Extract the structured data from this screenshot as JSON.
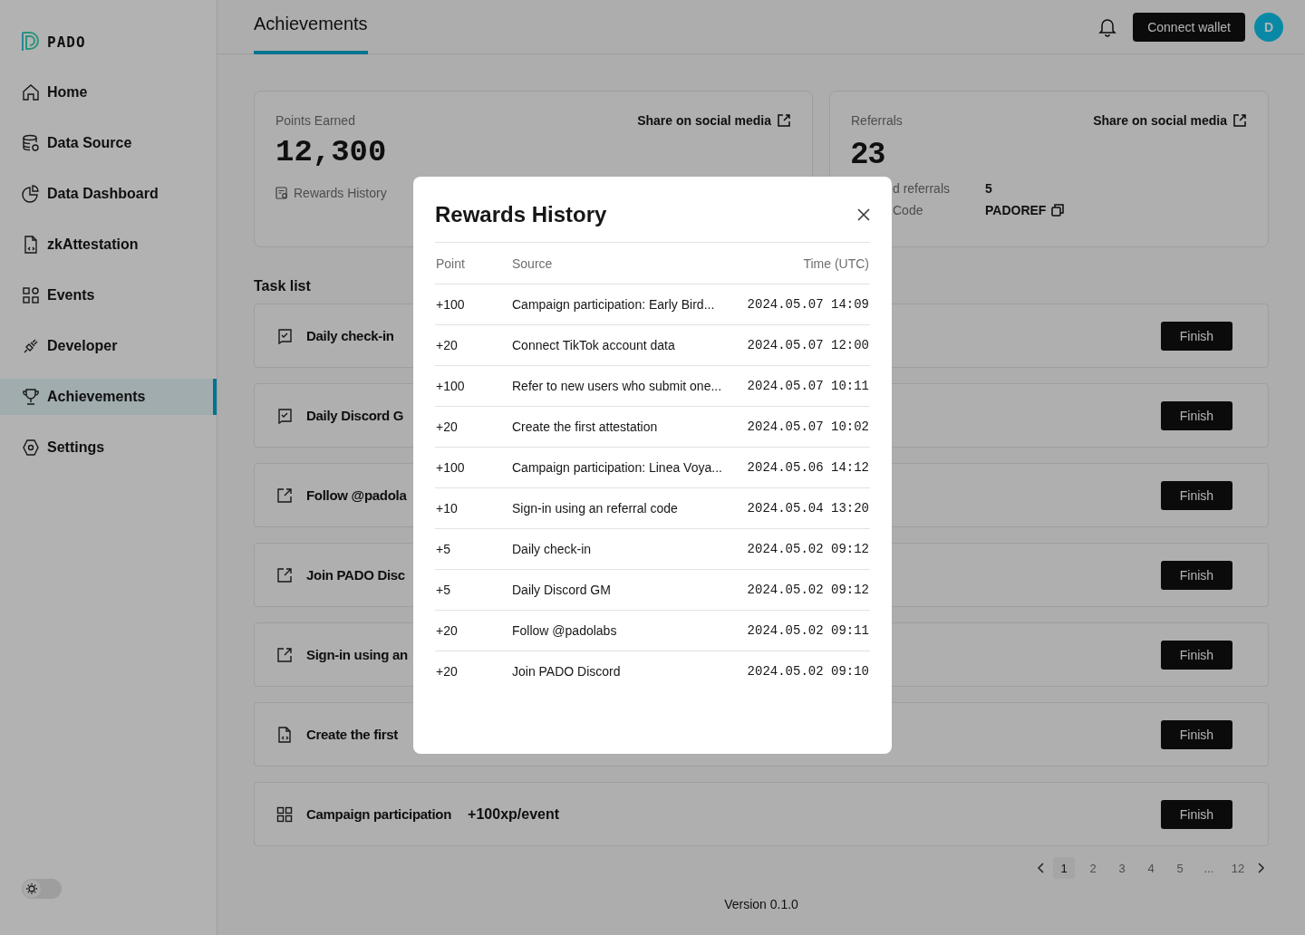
{
  "sidebar": {
    "logo": "PADO",
    "items": [
      {
        "label": "Home",
        "kind": "home",
        "selected": false
      },
      {
        "label": "Data Source",
        "kind": "database",
        "selected": false
      },
      {
        "label": "Data Dashboard",
        "kind": "pie",
        "selected": false
      },
      {
        "label": "zkAttestation",
        "kind": "file",
        "selected": false
      },
      {
        "label": "Events",
        "kind": "grid",
        "selected": false
      },
      {
        "label": "Developer",
        "kind": "plug",
        "selected": false
      },
      {
        "label": "Achievements",
        "kind": "trophy",
        "selected": true
      },
      {
        "label": "Settings",
        "kind": "gear",
        "selected": false
      }
    ],
    "theme_toggle": {
      "dark": false
    }
  },
  "header": {
    "tabs": [
      {
        "label": "Achievements",
        "selected": true
      }
    ],
    "connect_button": "Connect wallet",
    "avatar": "D"
  },
  "points_card": {
    "label": "Points Earned",
    "value": "12,300",
    "history_link": "Rewards History",
    "share_link": "Share on social media"
  },
  "referrals_card": {
    "label": "Referrals",
    "value": "23",
    "share_link": "Share on social media",
    "rows": [
      {
        "label": "d referrals",
        "value": "5",
        "copy": false
      },
      {
        "label": "Code",
        "value": "PADOREF",
        "copy": true
      }
    ]
  },
  "task_list": {
    "title": "Task list",
    "tasks": [
      {
        "kind": "chat",
        "name": "Daily check-in",
        "button": "Finish"
      },
      {
        "kind": "chat",
        "name": "Daily Discord G",
        "button": "Finish"
      },
      {
        "kind": "link",
        "name": "Follow @padola",
        "button": "Finish"
      },
      {
        "kind": "link",
        "name": "Join PADO Disc",
        "button": "Finish"
      },
      {
        "kind": "link",
        "name": "Sign-in using an",
        "button": "Finish"
      },
      {
        "kind": "file",
        "name": "Create the first",
        "button": "Finish"
      },
      {
        "kind": "grid",
        "name": "Campaign participation",
        "reward": "+100xp/event",
        "button": "Finish"
      }
    ]
  },
  "pagination": {
    "pages": [
      {
        "label": "1",
        "selected": true
      },
      {
        "label": "2",
        "selected": false
      },
      {
        "label": "3",
        "selected": false
      },
      {
        "label": "4",
        "selected": false
      },
      {
        "label": "5",
        "selected": false
      },
      {
        "label": "...",
        "selected": false
      },
      {
        "label": "12",
        "selected": false
      }
    ]
  },
  "version": "Version 0.1.0",
  "modal": {
    "title": "Rewards History",
    "columns": [
      "Point",
      "Source",
      "Time (UTC)"
    ],
    "rows": [
      {
        "point": "+100",
        "source": "Campaign participation: Early Bird...",
        "time": "2024.05.07 14:09"
      },
      {
        "point": "+20",
        "source": "Connect TikTok account data",
        "time": "2024.05.07 12:00"
      },
      {
        "point": "+100",
        "source": "Refer to new users who submit one...",
        "time": "2024.05.07 10:11"
      },
      {
        "point": "+20",
        "source": "Create the first attestation",
        "time": "2024.05.07 10:02"
      },
      {
        "point": "+100",
        "source": "Campaign participation: Linea Voya...",
        "time": "2024.05.06 14:12"
      },
      {
        "point": "+10",
        "source": "Sign-in using an referral code",
        "time": "2024.05.04 13:20"
      },
      {
        "point": "+5",
        "source": "Daily check-in",
        "time": "2024.05.02 09:12"
      },
      {
        "point": "+5",
        "source": "Daily Discord GM",
        "time": "2024.05.02 09:12"
      },
      {
        "point": "+20",
        "source": "Follow @padolabs",
        "time": "2024.05.02 09:11"
      },
      {
        "point": "+20",
        "source": "Join PADO Discord",
        "time": "2024.05.02 09:10"
      }
    ]
  }
}
